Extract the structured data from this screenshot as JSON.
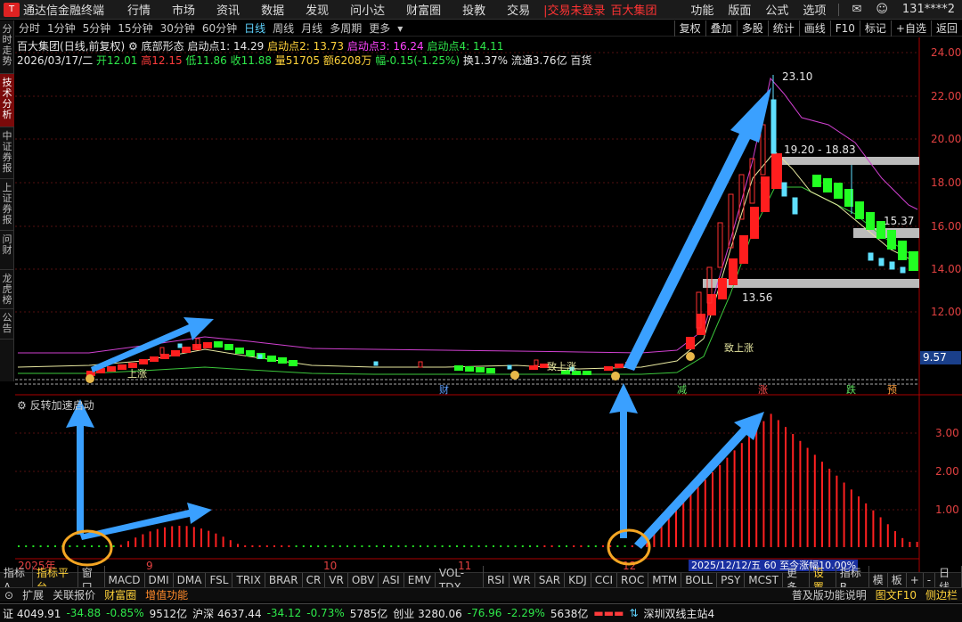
{
  "menu": {
    "app_title": "通达信金融终端",
    "items": [
      "行情",
      "市场",
      "资讯",
      "数据",
      "发现",
      "问小达",
      "财富圈",
      "投教",
      "交易"
    ],
    "login": "|交易未登录",
    "stock_tag": "百大集团",
    "right_items": [
      "功能",
      "版面",
      "公式",
      "选项"
    ],
    "account": "131****2"
  },
  "vtabs": [
    "分时走势",
    "技术分析",
    "中证券报",
    "上证券报",
    "问财",
    "龙虎榜",
    "公告"
  ],
  "periods": [
    "分时",
    "1分钟",
    "5分钟",
    "15分钟",
    "30分钟",
    "60分钟",
    "日线",
    "周线",
    "月线",
    "多周期",
    "更多"
  ],
  "active_period": "日线",
  "rbtns": [
    "复权",
    "叠加",
    "多股",
    "统计",
    "画线",
    "F10",
    "标记",
    "+自选",
    "返回"
  ],
  "info1": {
    "name": "百大集团",
    "mode": "(日线,前复权)",
    "formula": "底部形态",
    "p1": "启动点1: 14.29",
    "p2": "启动点2: 13.73",
    "p3": "启动点3: 16.24",
    "p4": "启动点4: 14.11"
  },
  "info2": {
    "date": "2026/03/17/二",
    "open": "开12.01",
    "high": "高12.15",
    "low": "低11.86",
    "close": "收11.88",
    "vol": "量51705",
    "amt": "额6208万",
    "chg": "幅-0.15(-1.25%)",
    "turn": "换1.37%",
    "flow": "流通3.76亿",
    "sector": "百货"
  },
  "axis": {
    "price": [
      "24.00",
      "22.00",
      "20.00",
      "18.00",
      "16.00",
      "14.00",
      "12.00"
    ],
    "current": "9.57",
    "ind": [
      "3.00",
      "2.00",
      "1.00"
    ],
    "months": [
      "2025年",
      "9",
      "10",
      "11",
      "12"
    ]
  },
  "annotations": {
    "high": "23.10",
    "band1": "19.20 - 18.83",
    "band2": "15.37",
    "low": "13.56",
    "signal1": "上涨",
    "signal2": "致上涨",
    "signal3": "致上涨"
  },
  "event_markers": [
    "财",
    "减",
    "涨",
    "跌",
    "预"
  ],
  "indicator": {
    "title": "反转加速启动",
    "tooltip": "2025/12/12/五 60 至今涨幅10.00%"
  },
  "tabs": [
    "指标A",
    "指标平台",
    "窗口",
    "MACD",
    "DMI",
    "DMA",
    "FSL",
    "TRIX",
    "BRAR",
    "CR",
    "VR",
    "OBV",
    "ASI",
    "EMV",
    "VOL-TDX",
    "RSI",
    "WR",
    "SAR",
    "KDJ",
    "CCI",
    "ROC",
    "MTM",
    "BOLL",
    "PSY",
    "MCST",
    "更多",
    "设置"
  ],
  "tabs_right": [
    "指标B",
    "模",
    "板",
    "+",
    "-",
    "日线"
  ],
  "row2": {
    "expand": "扩展",
    "related": "关联报价",
    "wealth": "财富圈",
    "addon": "增值功能",
    "help": "普及版功能说明",
    "f10": "图文F10",
    "side": "侧边栏"
  },
  "status": {
    "sh": "证 4049.91",
    "sh_chg": "-34.88",
    "sh_pct": "-0.85%",
    "sh_amt": "9512亿",
    "sz": "沪深 4637.44",
    "sz_chg": "-34.12",
    "sz_pct": "-0.73%",
    "sz_amt": "5785亿",
    "cy": "创业 3280.06",
    "cy_chg": "-76.96",
    "cy_pct": "-2.29%",
    "cy_amt": "5638亿",
    "station": "深圳双线主站4"
  }
}
